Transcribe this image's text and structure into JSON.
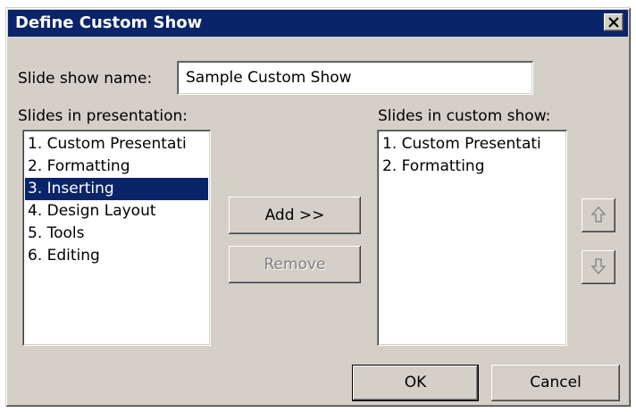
{
  "dialog": {
    "title": "Define Custom Show",
    "close_icon": "close-icon"
  },
  "name": {
    "label": "Slide show name:",
    "value": "Sample Custom Show"
  },
  "presentation": {
    "label": "Slides in presentation:",
    "items": [
      "1. Custom Presentati",
      "2. Formatting",
      "3. Inserting",
      "4. Design Layout",
      "5. Tools",
      "6. Editing"
    ],
    "selected_index": 2
  },
  "custom_show": {
    "label": "Slides in custom show:",
    "items": [
      "1. Custom Presentati",
      "2. Formatting"
    ]
  },
  "buttons": {
    "add": "Add >>",
    "remove": "Remove",
    "ok": "OK",
    "cancel": "Cancel"
  },
  "icons": {
    "move_up": "arrow-up-icon",
    "move_down": "arrow-down-icon"
  },
  "colors": {
    "title_bar": "#0a246a",
    "selection": "#0a246a",
    "face": "#d4d0c8"
  }
}
